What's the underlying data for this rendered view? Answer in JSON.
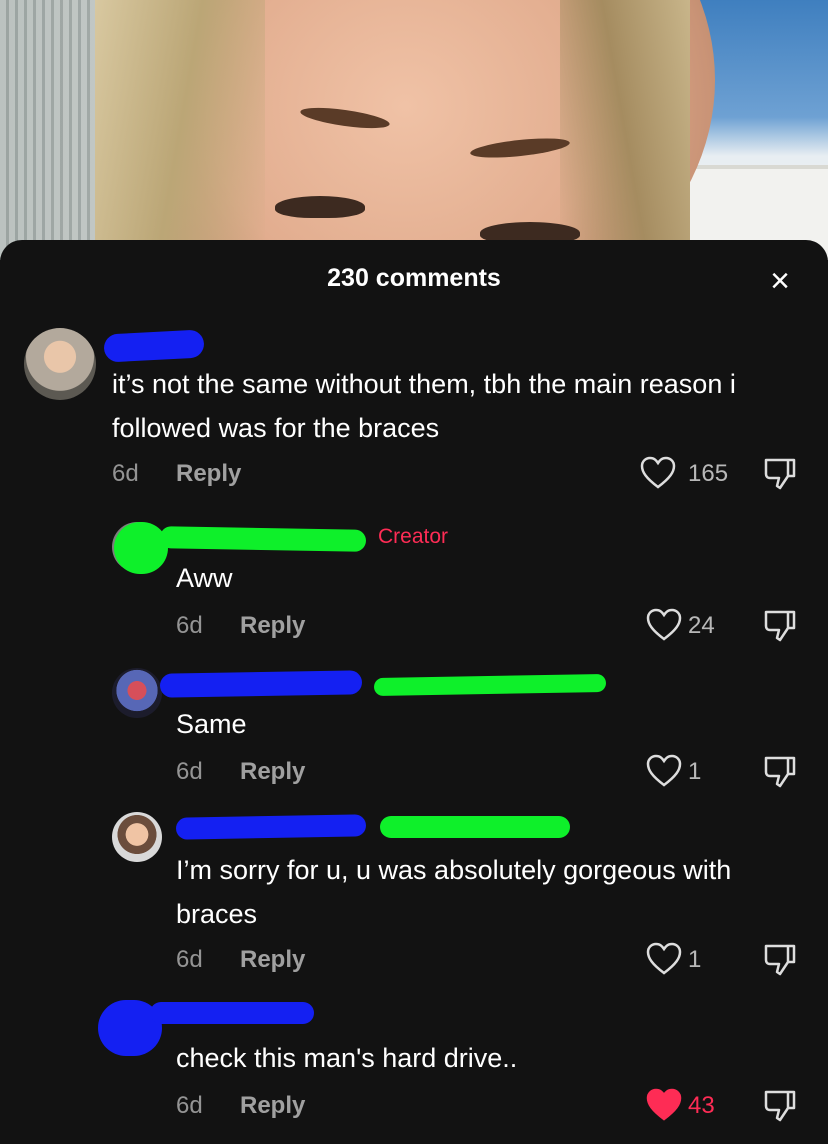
{
  "header": {
    "title": "230 comments",
    "close_symbol": "×"
  },
  "comments": [
    {
      "username": "",
      "text": "it’s not the same without them, tbh the main reason i followed was for the braces",
      "age": "6d",
      "reply_label": "Reply",
      "likes": "165",
      "liked": false
    },
    {
      "username": "",
      "creator_tag": "Creator",
      "text": "Aww",
      "age": "6d",
      "reply_label": "Reply",
      "likes": "24",
      "liked": false
    },
    {
      "username": "",
      "text": "Same",
      "age": "6d",
      "reply_label": "Reply",
      "likes": "1",
      "liked": false
    },
    {
      "username": "",
      "text": "I’m sorry for u, u was absolutely gorgeous with braces",
      "age": "6d",
      "reply_label": "Reply",
      "likes": "1",
      "liked": false
    },
    {
      "username": "",
      "text": "check this man's hard drive..",
      "age": "6d",
      "reply_label": "Reply",
      "likes": "43",
      "liked": true
    }
  ],
  "colors": {
    "background": "#121212",
    "accent_red": "#fe2c55",
    "redaction_blue": "#1420f2",
    "redaction_green": "#0ef02a"
  },
  "icons": {
    "like": "heart-outline-icon",
    "liked": "heart-filled-icon",
    "dislike": "thumbs-down-icon",
    "close": "close-icon"
  }
}
